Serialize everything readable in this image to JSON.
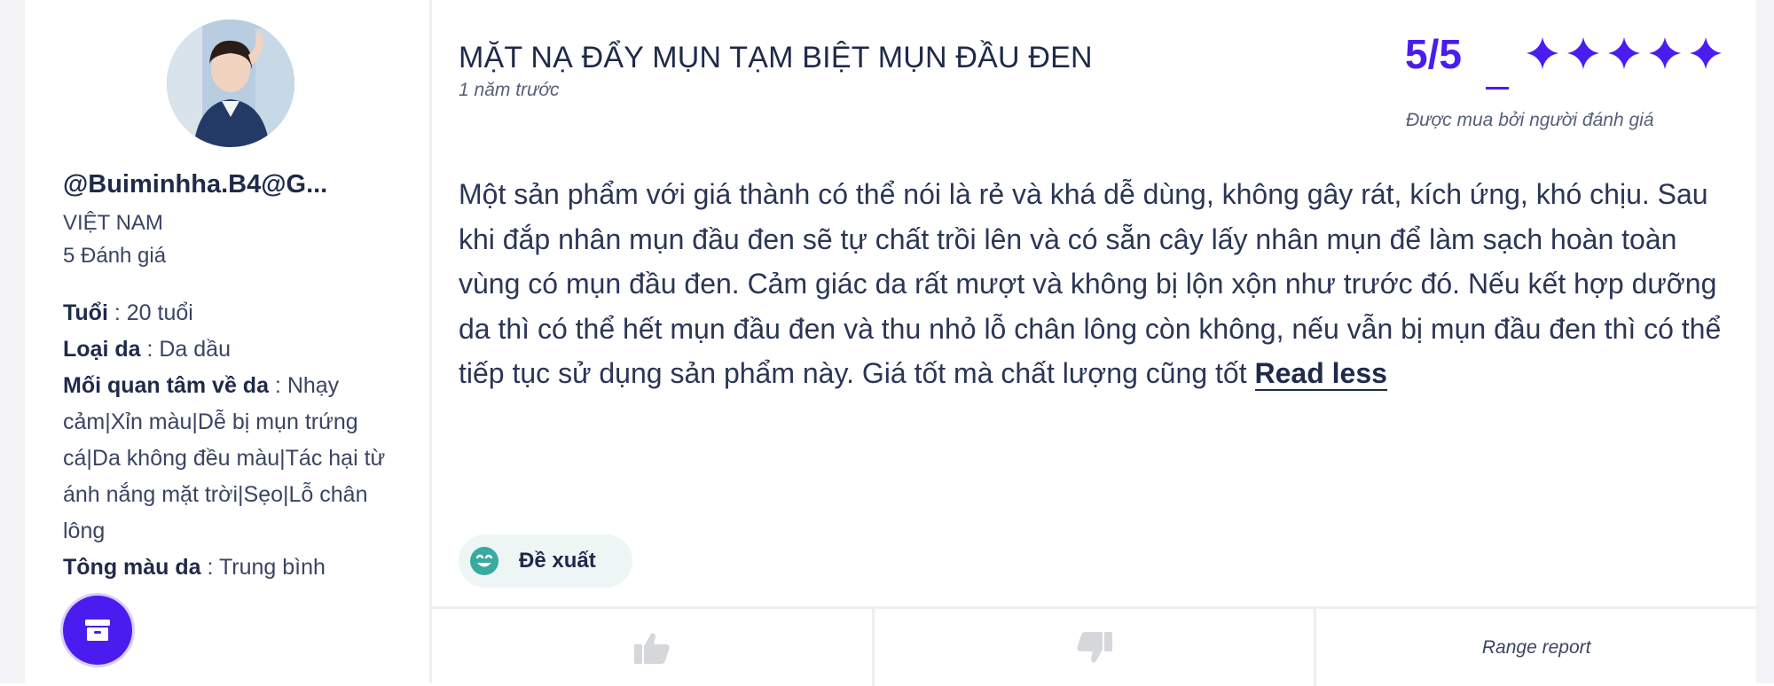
{
  "reviewer": {
    "username": "@Buiminhha.B4@G...",
    "country": "VIỆT NAM",
    "review_count": "5 Đánh giá",
    "attributes": [
      {
        "label": "Tuổi",
        "value": " : 20 tuổi"
      },
      {
        "label": "Loại da",
        "value": " : Da dầu"
      },
      {
        "label": "Mối quan tâm về da",
        "value": " : Nhạy cảm|Xỉn màu|Dễ bị mụn trứng cá|Da không đều màu|Tác hại từ ánh nắng mặt trời|Sẹo|Lỗ chân lông"
      },
      {
        "label": "Tông màu da",
        "value": " : Trung bình"
      }
    ]
  },
  "review": {
    "title": "MẶT NẠ ĐẨY MỤN TẠM BIỆT MỤN ĐẦU ĐEN",
    "time": "1 năm trước",
    "score": "5/5",
    "stars": 5,
    "verified": "Được mua bởi người đánh giá",
    "body": "Một sản phẩm với giá thành có thể nói là rẻ và khá dễ dùng, không gây rát, kích ứng, khó chịu. Sau khi đắp nhân mụn đầu đen sẽ tự chất trồi lên và có sẵn cây lấy nhân mụn để làm sạch hoàn toàn vùng có mụn đầu đen. Cảm giác da rất mượt và không bị lộn xộn như trước đó. Nếu kết hợp dưỡng da thì có thể hết mụn đầu đen và thu nhỏ lỗ chân lông còn không, nếu vẫn bị mụn đầu đen thì có thể tiếp tục sử dụng sản phẩm này. Giá tốt mà chất lượng cũng tốt",
    "read_less": "Read less",
    "recommend_label": "Đề xuất"
  },
  "footer": {
    "like_icon": "thumbs-up-icon",
    "dislike_icon": "thumbs-down-icon",
    "report_label": "Range report"
  },
  "colors": {
    "accent": "#4b1cf0",
    "text_dark": "#1f2a4a",
    "recommend_bg": "#eef6f5",
    "recommend_icon": "#3aa99f"
  }
}
